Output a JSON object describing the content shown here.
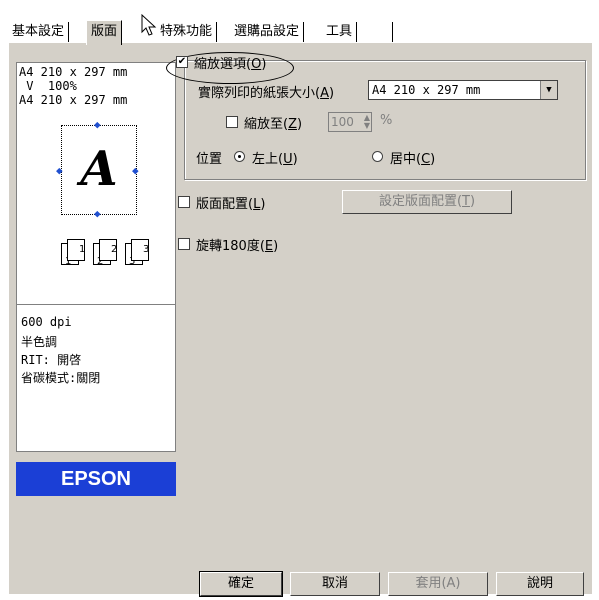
{
  "tabs": [
    {
      "label": "基本設定"
    },
    {
      "label": "版面"
    },
    {
      "label": "特殊功能"
    },
    {
      "label": "選購品設定"
    },
    {
      "label": "工具"
    }
  ],
  "preview": {
    "lines": [
      "A4 210 x 297 mm",
      " V  100%",
      "A4 210 x 297 mm"
    ],
    "page_letter": "A",
    "mini_pages": [
      {
        "a": "1",
        "b": "1"
      },
      {
        "a": "2",
        "b": "2"
      },
      {
        "a": "3",
        "b": "3"
      }
    ]
  },
  "info": {
    "lines": [
      "600 dpi",
      "半色調",
      "RIT: 開啓",
      "省碳模式:關閉"
    ]
  },
  "logo": "EPSON",
  "zoom": {
    "checkbox_label": "縮放選項(",
    "checkbox_hotkey": "O",
    "checkbox_suffix": ")",
    "checked": true,
    "paper_label": "實際列印的紙張大小(",
    "paper_hotkey": "A",
    "paper_suffix": ")",
    "paper_value": "A4 210 x 297 mm",
    "scale_label": "縮放至(",
    "scale_hotkey": "Z",
    "scale_suffix": ")",
    "scale_value": "100",
    "scale_unit": "%",
    "position_label": "位置",
    "pos_left": "左上(",
    "pos_left_hotkey": "U",
    "pos_left_suffix": ")",
    "pos_center": "居中(",
    "pos_center_hotkey": "C",
    "pos_center_suffix": ")"
  },
  "layout": {
    "checkbox_label": "版面配置(",
    "checkbox_hotkey": "L",
    "checkbox_suffix": ")",
    "button_label": "設定版面配置(",
    "button_hotkey": "T",
    "button_suffix": ")"
  },
  "rotate": {
    "checkbox_label": "旋轉180度(",
    "checkbox_hotkey": "E",
    "checkbox_suffix": ")"
  },
  "footer": {
    "ok": "確定",
    "cancel": "取消",
    "apply": "套用(A)",
    "help": "說明"
  }
}
